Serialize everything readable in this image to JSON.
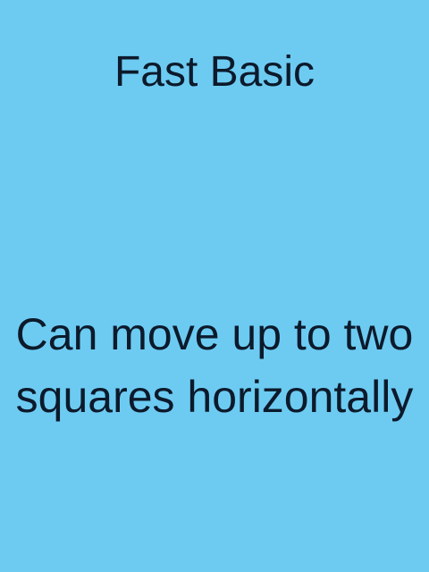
{
  "card": {
    "title": "Fast Basic",
    "description": "Can move up to two squares horizontally",
    "background_color": "#6dcbf2",
    "text_color": "#0c1a2b"
  }
}
